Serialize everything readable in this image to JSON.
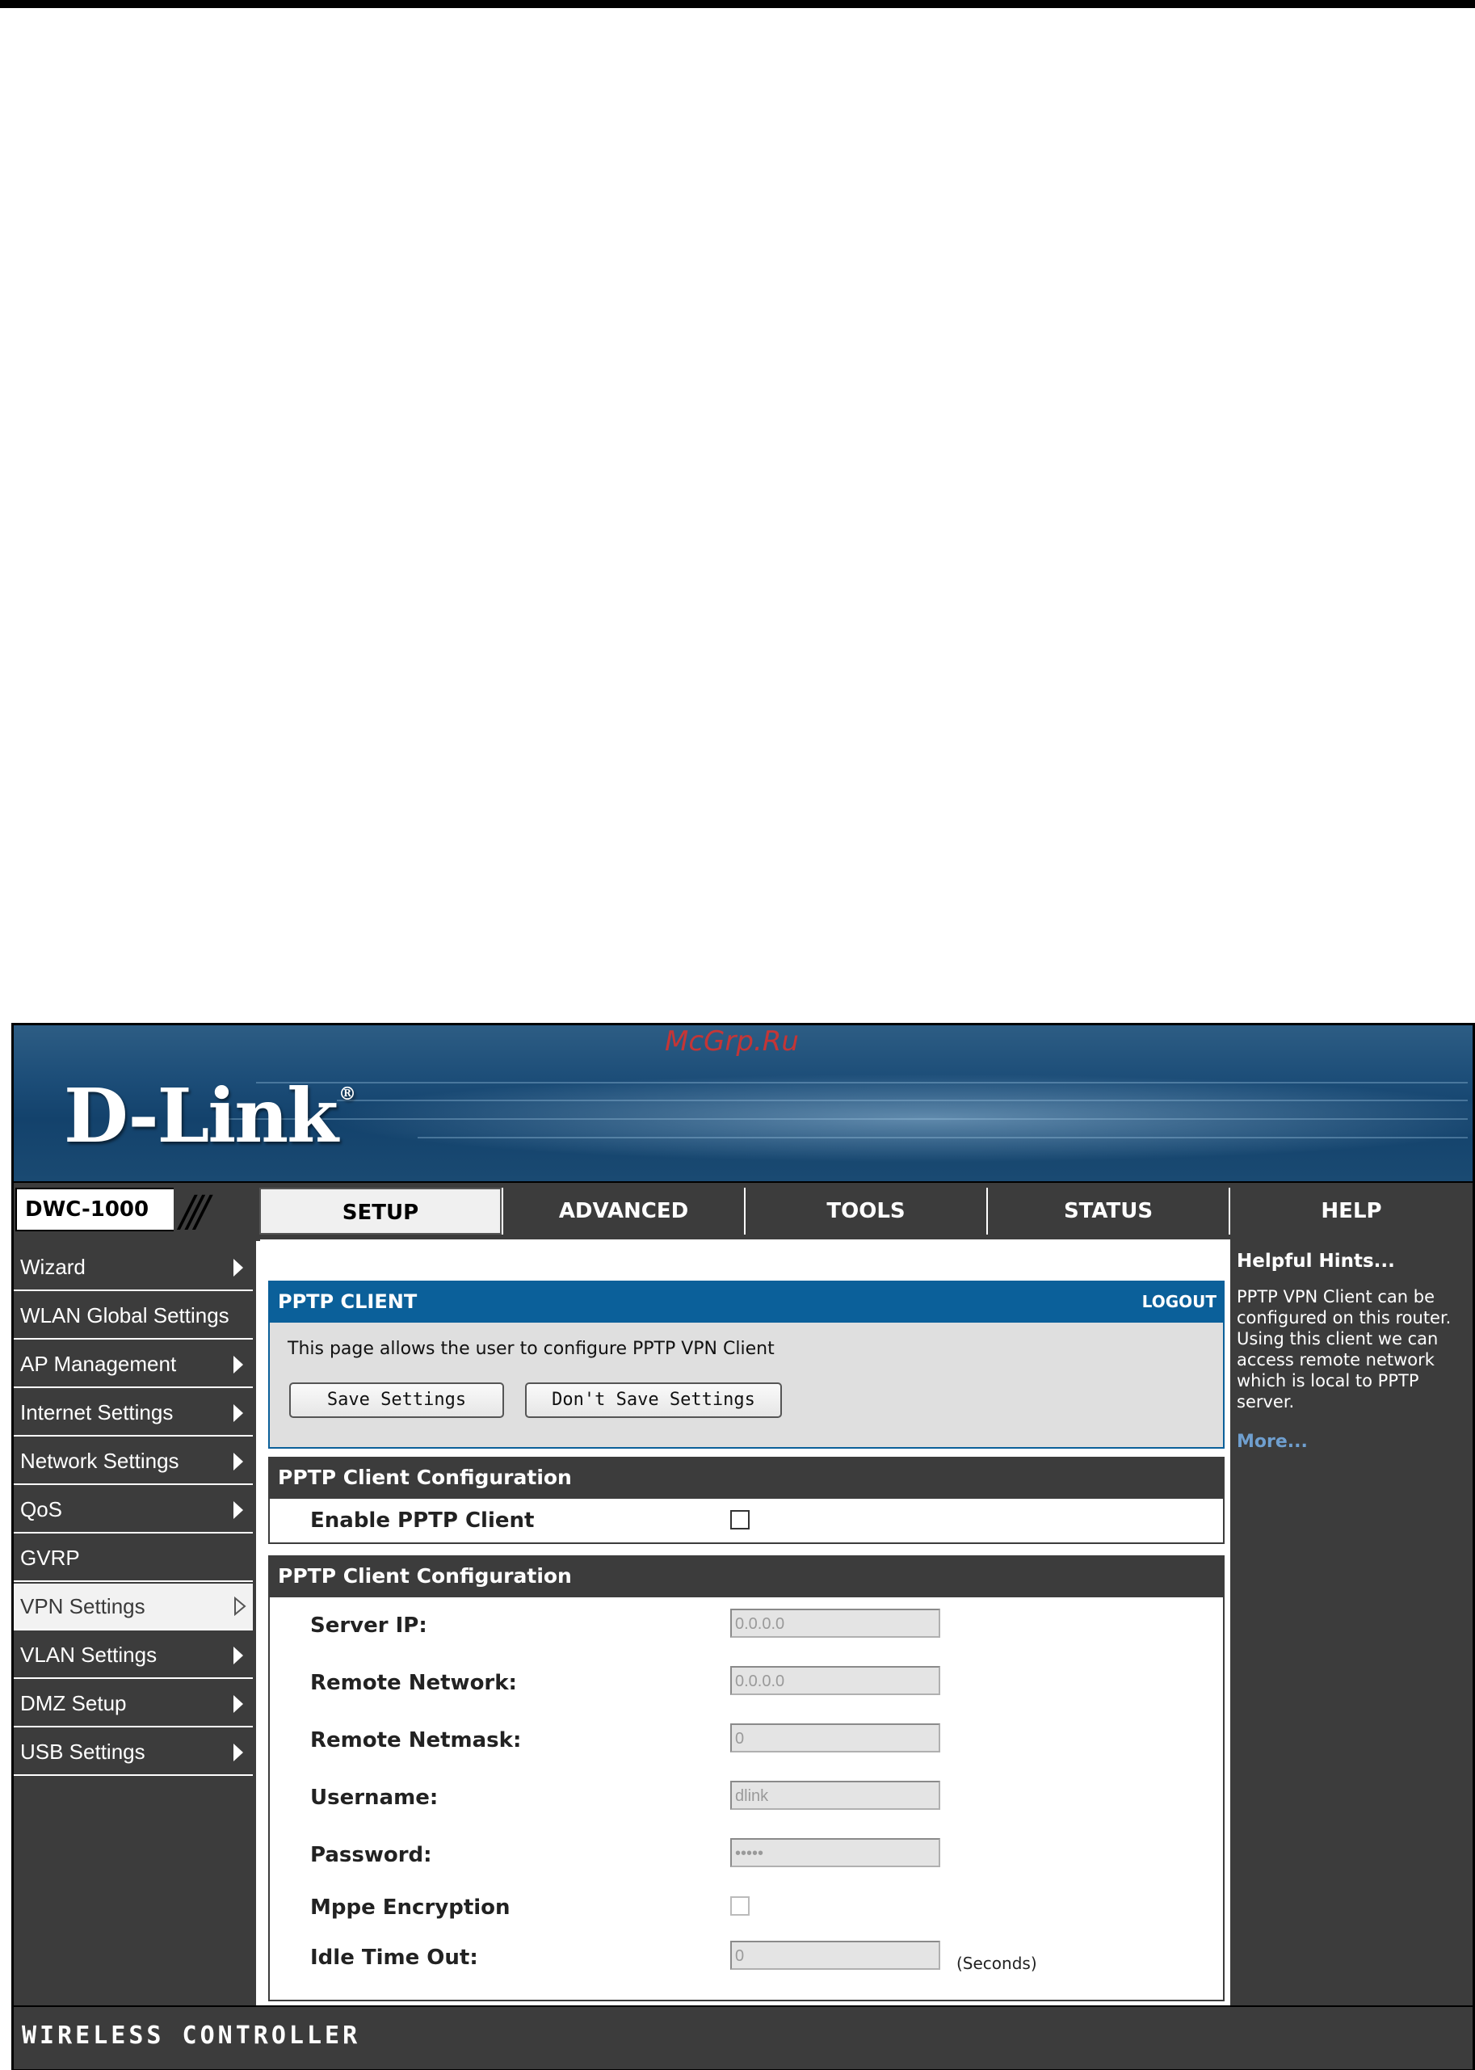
{
  "watermark": "McGrp.Ru",
  "brand": {
    "logo_text": "D-Link",
    "registered_mark": "®"
  },
  "model": "DWC-1000",
  "tabs": [
    {
      "label": "SETUP",
      "active": true
    },
    {
      "label": "ADVANCED",
      "active": false
    },
    {
      "label": "TOOLS",
      "active": false
    },
    {
      "label": "STATUS",
      "active": false
    },
    {
      "label": "HELP",
      "active": false
    }
  ],
  "sidebar": {
    "items": [
      {
        "label": "Wizard",
        "has_submenu": true
      },
      {
        "label": "WLAN Global Settings",
        "has_submenu": false
      },
      {
        "label": "AP Management",
        "has_submenu": true
      },
      {
        "label": "Internet Settings",
        "has_submenu": true
      },
      {
        "label": "Network Settings",
        "has_submenu": true
      },
      {
        "label": "QoS",
        "has_submenu": true
      },
      {
        "label": "GVRP",
        "has_submenu": false
      },
      {
        "label": "VPN Settings",
        "has_submenu": true,
        "active": true
      },
      {
        "label": "VLAN Settings",
        "has_submenu": true
      },
      {
        "label": "DMZ Setup",
        "has_submenu": true
      },
      {
        "label": "USB Settings",
        "has_submenu": true
      }
    ]
  },
  "panel": {
    "title": "PPTP CLIENT",
    "logout": "LOGOUT",
    "description": "This page allows the user to configure PPTP VPN Client",
    "save_label": "Save Settings",
    "dont_save_label": "Don't Save Settings"
  },
  "section1": {
    "title": "PPTP Client Configuration",
    "enable_label": "Enable PPTP Client",
    "enable_checked": false
  },
  "section2": {
    "title": "PPTP Client Configuration",
    "fields": {
      "server_ip": {
        "label": "Server IP:",
        "value": "0.0.0.0"
      },
      "remote_network": {
        "label": "Remote Network:",
        "value": "0.0.0.0"
      },
      "remote_netmask": {
        "label": "Remote Netmask:",
        "value": "0"
      },
      "username": {
        "label": "Username:",
        "value": "dlink"
      },
      "password": {
        "label": "Password:",
        "value": "•••••"
      },
      "mppe": {
        "label": "Mppe Encryption",
        "checked": false
      },
      "idle_timeout": {
        "label": "Idle Time Out:",
        "value": "0",
        "unit": "(Seconds)"
      }
    }
  },
  "hints": {
    "title": "Helpful Hints...",
    "body": "PPTP VPN Client can be configured on this router. Using this client we can access remote network which is local to PPTP server.",
    "more": "More..."
  },
  "footer": "WIRELESS CONTROLLER",
  "colors": {
    "banner_blue": "#1c4d78",
    "panel_blue": "#0b609a",
    "dark_gray": "#3c3c3c",
    "panel_body_gray": "#dfdfdf",
    "link_blue": "#6f9fcf",
    "watermark_red": "#e0302a"
  }
}
